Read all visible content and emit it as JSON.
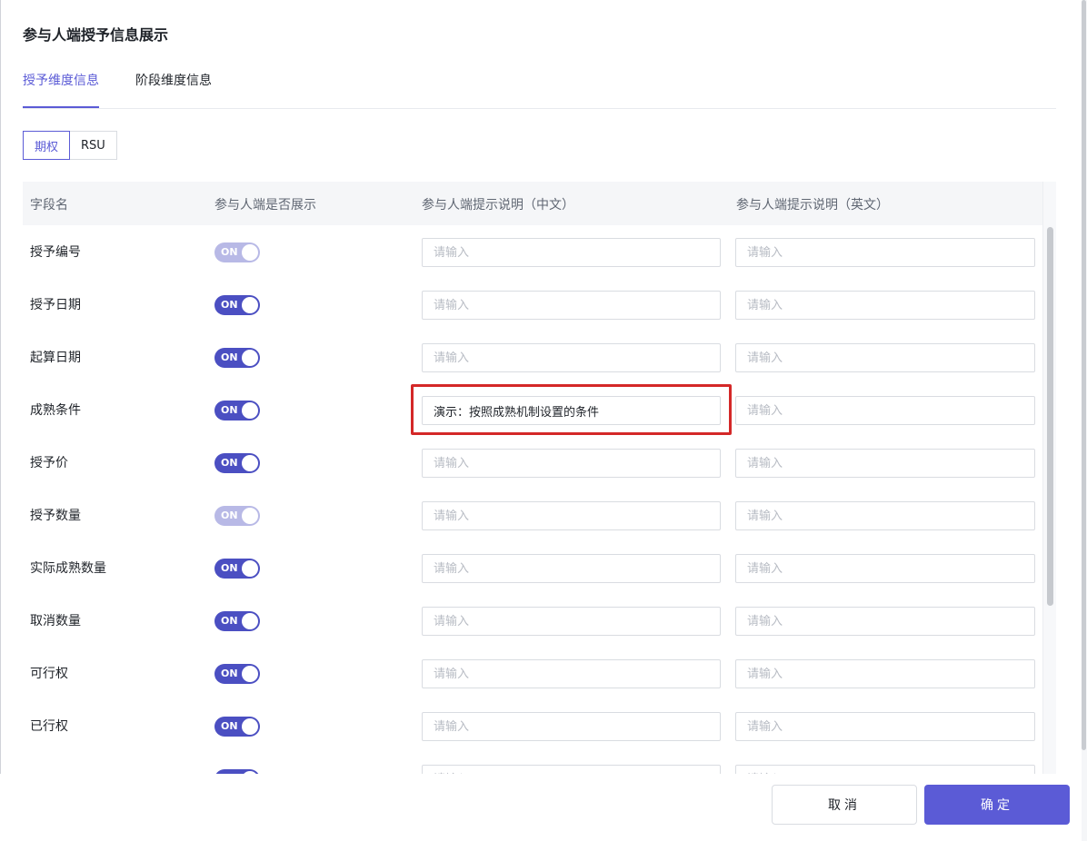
{
  "dialog": {
    "title": "参与人端授予信息展示"
  },
  "tabs": [
    {
      "label": "授予维度信息",
      "active": true
    },
    {
      "label": "阶段维度信息",
      "active": false
    }
  ],
  "segment": [
    {
      "label": "期权",
      "active": true
    },
    {
      "label": "RSU",
      "active": false
    }
  ],
  "table": {
    "headers": [
      "字段名",
      "参与人端是否展示",
      "参与人端提示说明（中文）",
      "参与人端提示说明（英文）"
    ],
    "placeholder": "请输入",
    "toggle_label": "ON",
    "rows": [
      {
        "name": "授予编号",
        "toggle_on": true,
        "toggle_disabled": true,
        "cn": "",
        "en": ""
      },
      {
        "name": "授予日期",
        "toggle_on": true,
        "toggle_disabled": false,
        "cn": "",
        "en": ""
      },
      {
        "name": "起算日期",
        "toggle_on": true,
        "toggle_disabled": false,
        "cn": "",
        "en": ""
      },
      {
        "name": "成熟条件",
        "toggle_on": true,
        "toggle_disabled": false,
        "cn": "演示：按照成熟机制设置的条件",
        "en": ""
      },
      {
        "name": "授予价",
        "toggle_on": true,
        "toggle_disabled": false,
        "cn": "",
        "en": ""
      },
      {
        "name": "授予数量",
        "toggle_on": true,
        "toggle_disabled": true,
        "cn": "",
        "en": ""
      },
      {
        "name": "实际成熟数量",
        "toggle_on": true,
        "toggle_disabled": false,
        "cn": "",
        "en": ""
      },
      {
        "name": "取消数量",
        "toggle_on": true,
        "toggle_disabled": false,
        "cn": "",
        "en": ""
      },
      {
        "name": "可行权",
        "toggle_on": true,
        "toggle_disabled": false,
        "cn": "",
        "en": ""
      },
      {
        "name": "已行权",
        "toggle_on": true,
        "toggle_disabled": false,
        "cn": "",
        "en": ""
      },
      {
        "name": "",
        "toggle_on": true,
        "toggle_disabled": false,
        "cn": "",
        "en": ""
      }
    ]
  },
  "footer": {
    "cancel_label": "取消",
    "ok_label": "确定"
  },
  "colors": {
    "accent": "#5b5bd6",
    "toggle_on": "#4b4fc2",
    "toggle_disabled": "#b8b9e6",
    "highlight": "#d42828"
  }
}
